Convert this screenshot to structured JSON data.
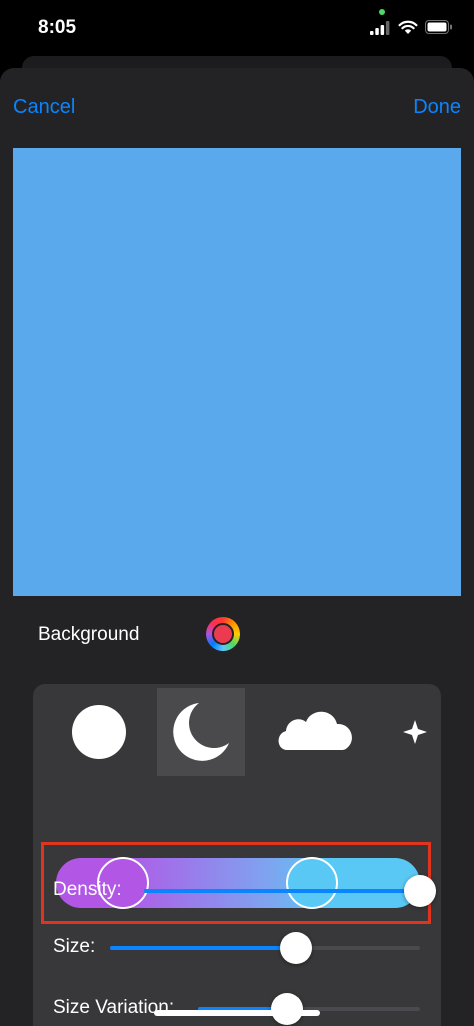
{
  "status_bar": {
    "time": "8:05",
    "icons": [
      "signal-icon",
      "wifi-icon",
      "battery-icon"
    ]
  },
  "nav": {
    "cancel_label": "Cancel",
    "done_label": "Done"
  },
  "colors": {
    "accent": "#0a84ff",
    "background_color": "#ec3b50",
    "gradient_start": "#b256e6",
    "gradient_end": "#5ac8f5",
    "highlight_border": "#e0341f"
  },
  "background_row": {
    "label": "Background"
  },
  "shapes": {
    "items": [
      "circle-icon",
      "moon-icon",
      "cloud-icon",
      "sparkle-icon"
    ],
    "selected": "moon-icon"
  },
  "gradient": {
    "stops": [
      0.18,
      0.7
    ]
  },
  "sliders": [
    {
      "label": "Density:",
      "value": 1.0
    },
    {
      "label": "Size:",
      "value": 0.6
    },
    {
      "label": "Size Variation:",
      "value": 0.4
    }
  ]
}
